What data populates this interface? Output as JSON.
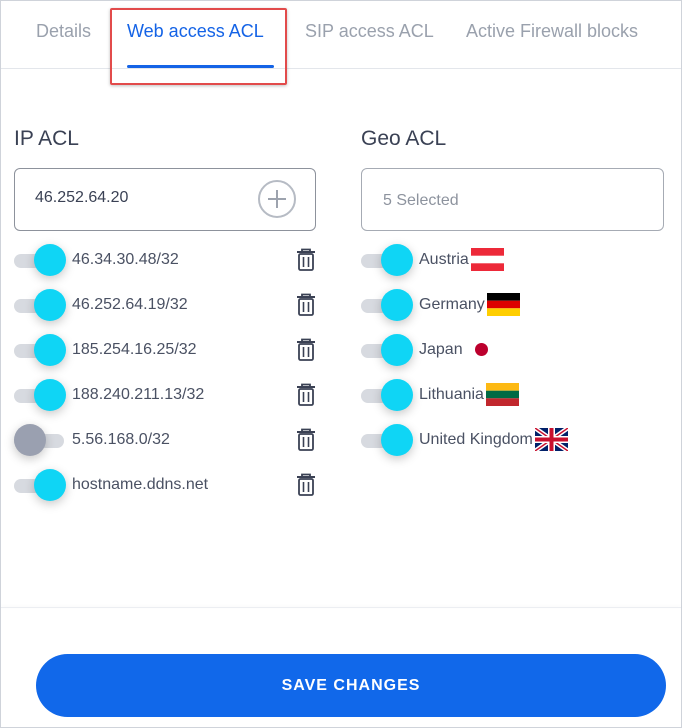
{
  "tabs": [
    {
      "label": "Details",
      "active": false
    },
    {
      "label": "Web access ACL",
      "active": true
    },
    {
      "label": "SIP access ACL",
      "active": false
    },
    {
      "label": "Active Firewall blocks",
      "active": false
    }
  ],
  "ip_acl": {
    "title": "IP ACL",
    "input_value": "46.252.64.20",
    "add_icon": "plus-circle-icon",
    "entries": [
      {
        "address": "46.34.30.48/32",
        "enabled": true
      },
      {
        "address": "46.252.64.19/32",
        "enabled": true
      },
      {
        "address": "185.254.16.25/32",
        "enabled": true
      },
      {
        "address": "188.240.211.13/32",
        "enabled": true
      },
      {
        "address": "5.56.168.0/32",
        "enabled": false
      },
      {
        "address": "hostname.ddns.net",
        "enabled": true
      }
    ]
  },
  "geo_acl": {
    "title": "Geo ACL",
    "select_text": "5 Selected",
    "countries": [
      {
        "name": "Austria",
        "enabled": true,
        "flag": "austria-flag-icon"
      },
      {
        "name": "Germany",
        "enabled": true,
        "flag": "germany-flag-icon"
      },
      {
        "name": "Japan",
        "enabled": true,
        "flag": "japan-flag-icon"
      },
      {
        "name": "Lithuania",
        "enabled": true,
        "flag": "lithuania-flag-icon"
      },
      {
        "name": "United Kingdom",
        "enabled": true,
        "flag": "uk-flag-icon"
      }
    ]
  },
  "footer": {
    "save_label": "SAVE CHANGES"
  },
  "colors": {
    "accent": "#1463e6",
    "toggle_on": "#0fd5f5",
    "toggle_off": "#9aa0b0",
    "highlight": "#e24b4b"
  }
}
